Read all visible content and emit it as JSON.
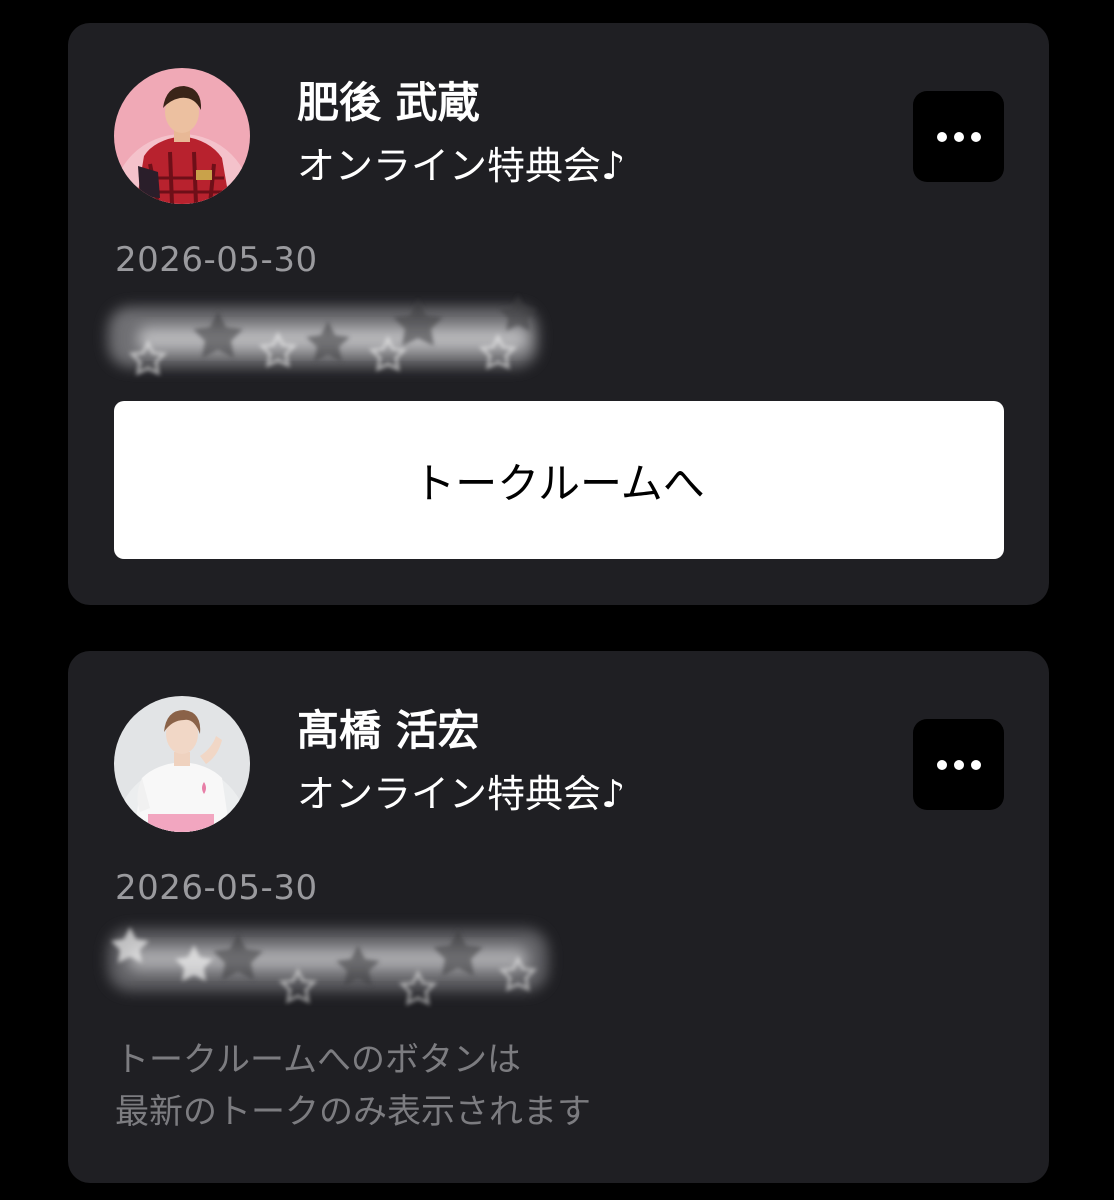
{
  "cards": [
    {
      "avatar_icon": "performer-photo-avatar",
      "name": "肥後 武蔵",
      "event_title": "オンライン特典会♪",
      "date": "2026-05-30",
      "more_icon": "ellipsis-icon",
      "button_label": "トークルームへ"
    },
    {
      "avatar_icon": "performer-photo-avatar",
      "name": "髙橋 活宏",
      "event_title": "オンライン特典会♪",
      "date": "2026-05-30",
      "more_icon": "ellipsis-icon",
      "note_lines": [
        "トークルームへのボタンは",
        "最新のトークのみ表示されます"
      ]
    }
  ],
  "colors": {
    "background": "#000000",
    "card": "#1f1f23",
    "button": "#ffffff",
    "date_text": "#9a9a9e",
    "note_text": "#7c7c80"
  }
}
